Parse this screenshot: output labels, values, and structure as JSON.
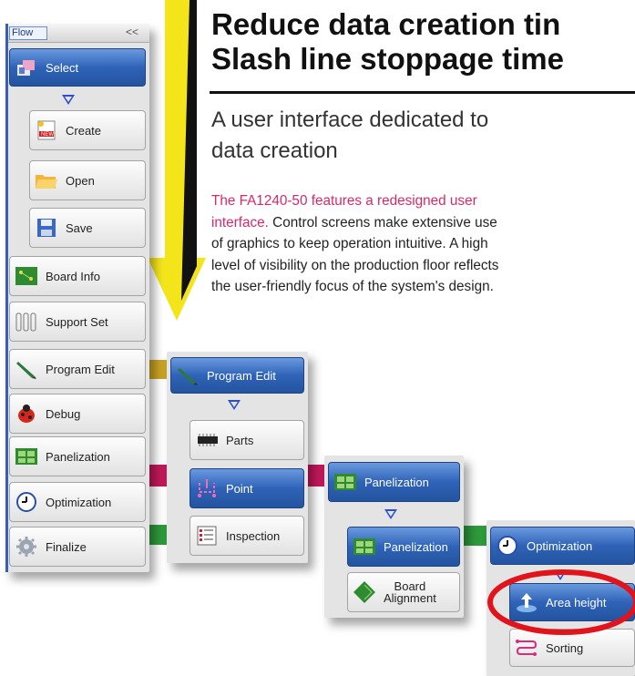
{
  "headline": {
    "line1": "Reduce data creation tin",
    "line2": "Slash line stoppage time"
  },
  "subheading": {
    "line1": "A user interface dedicated to",
    "line2": "data creation"
  },
  "body": {
    "lead": "The FA1240-50 features a redesigned user",
    "line2_pink": "interface.",
    "line2_rest": " Control screens make extensive use",
    "line3": "of graphics to keep operation intuitive. A high",
    "line4": "level of visibility on the production floor reflects",
    "line5": "the user-friendly focus of the system's design."
  },
  "flow_panel": {
    "title": "Flow",
    "collapse": "<<",
    "select": "Select",
    "create": "Create",
    "open": "Open",
    "save": "Save",
    "items": [
      "Board Info",
      "Support Set",
      "Program Edit",
      "Debug",
      "Panelization",
      "Optimization",
      "Finalize"
    ]
  },
  "program_edit_panel": {
    "header": "Program Edit",
    "items": [
      "Parts",
      "Point",
      "Inspection"
    ]
  },
  "panelization_panel": {
    "header": "Panelization",
    "items": [
      "Panelization",
      "Board\nAlignment"
    ]
  },
  "optimization_panel": {
    "header": "Optimization",
    "items": [
      "Area height",
      "Sorting"
    ]
  },
  "colors": {
    "accent_blue": "#2f63b8",
    "arrow_yellow": "#f4e51b",
    "connector_gold": "#c9a325",
    "connector_magenta": "#c2185b",
    "connector_green": "#2e9a3c",
    "highlight_red": "#e1141c",
    "pink_text": "#d8286a"
  }
}
